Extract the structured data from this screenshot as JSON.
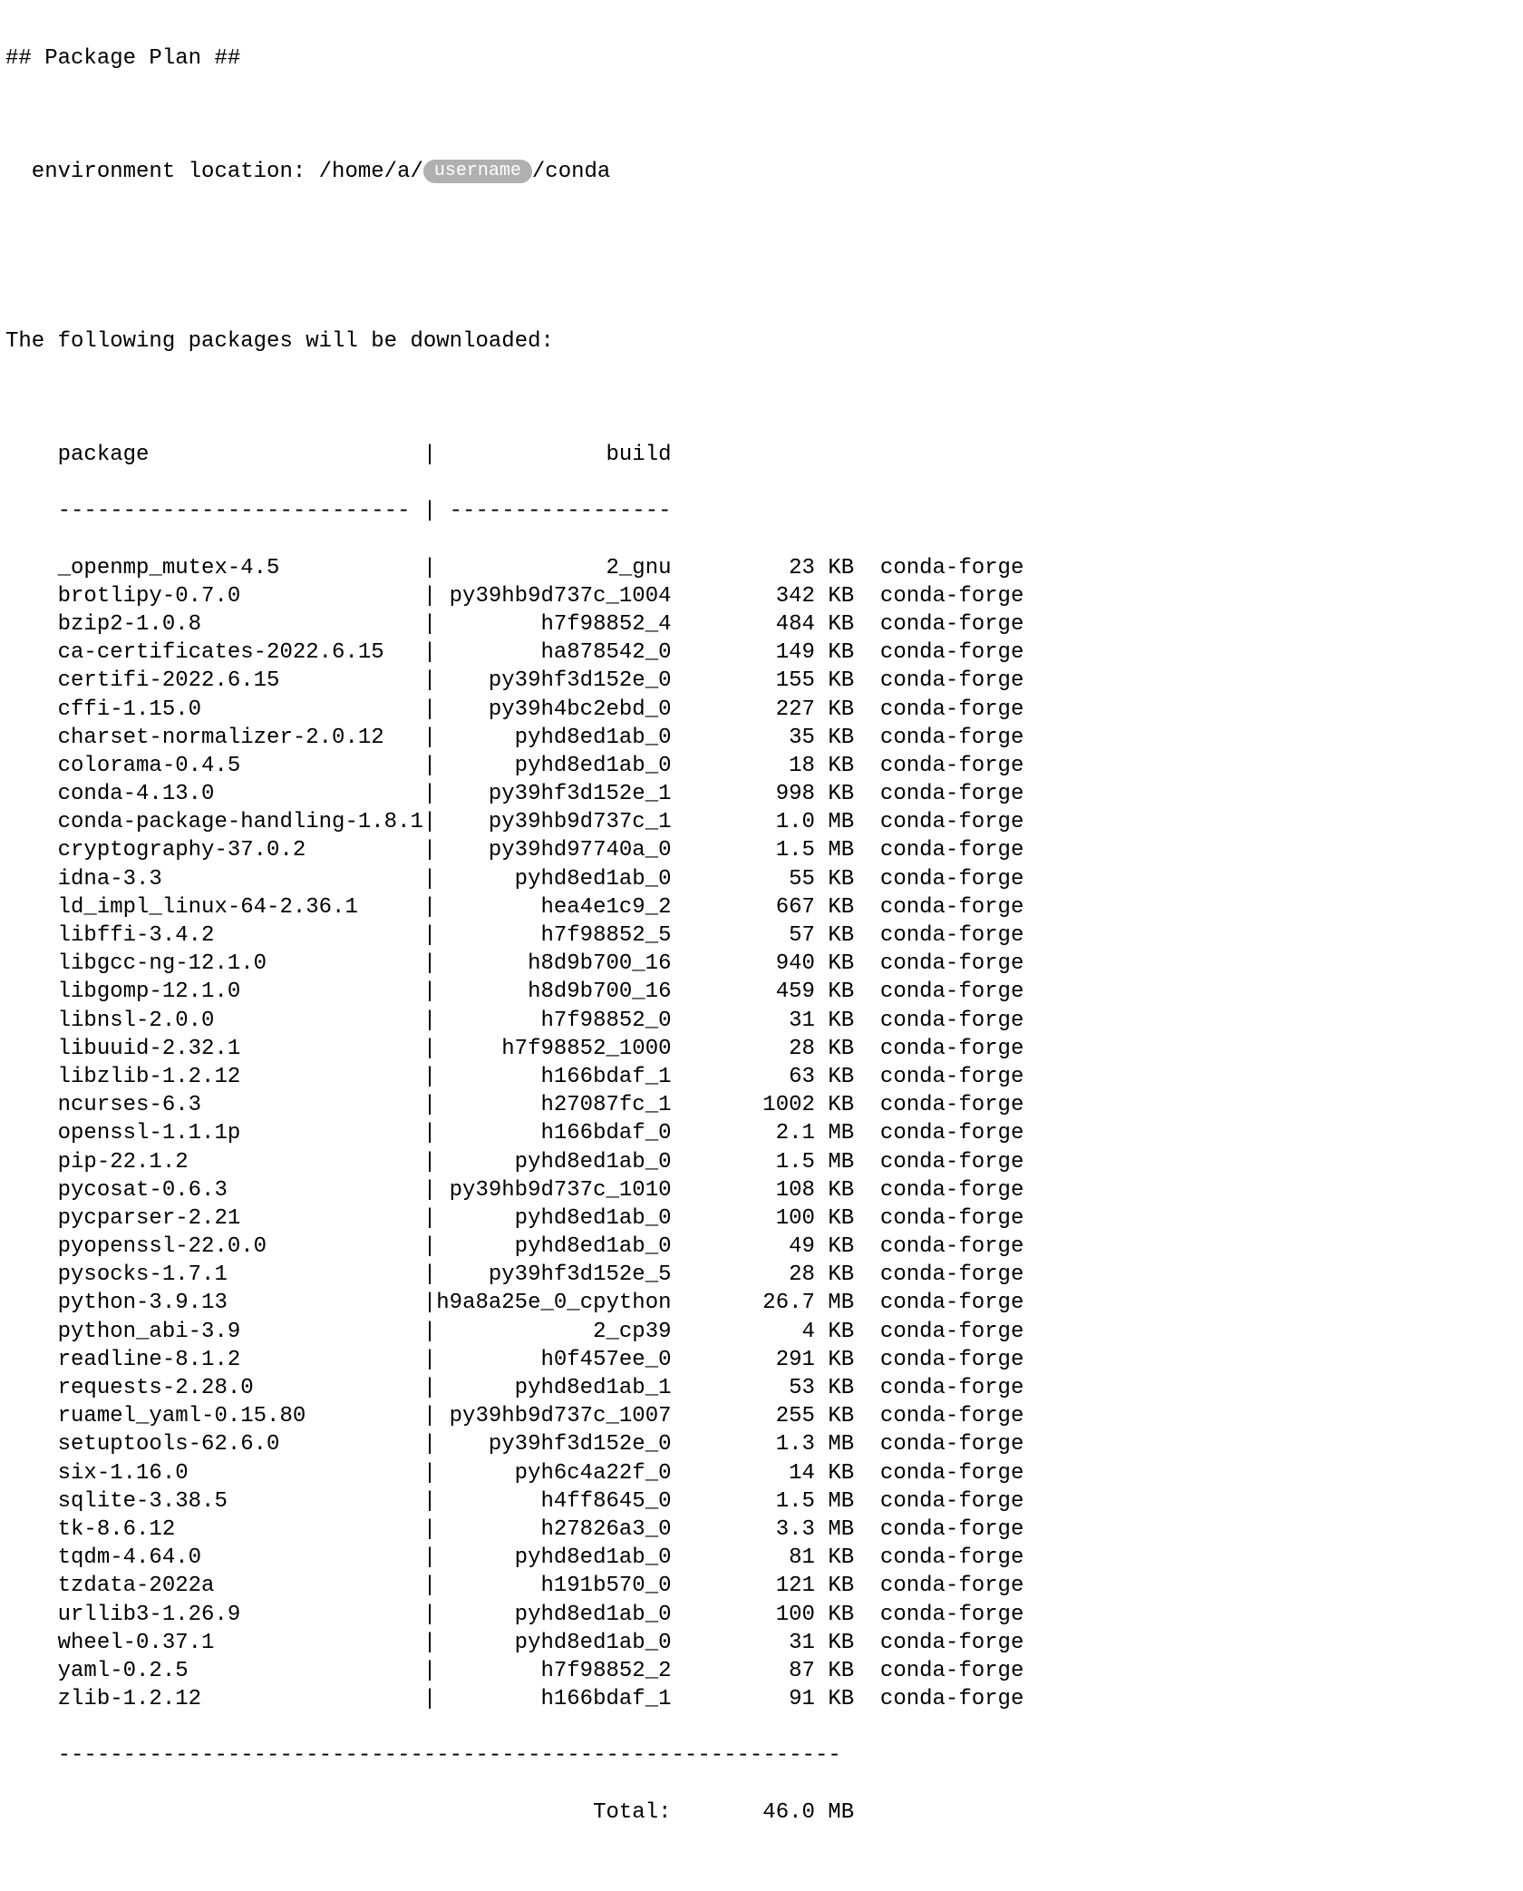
{
  "heading": "## Package Plan ##",
  "env_label_prefix": "  environment location: /home/a/",
  "env_redacted": "username",
  "env_label_suffix": "/conda",
  "download_heading": "The following packages will be downloaded:",
  "columns": {
    "package": "package",
    "build": "build"
  },
  "header_rule_left": "---------------------------",
  "header_rule_right": "-----------------",
  "packages": [
    {
      "name": "_openmp_mutex-4.5",
      "build": "2_gnu",
      "size": "23 KB",
      "channel": "conda-forge"
    },
    {
      "name": "brotlipy-0.7.0",
      "build": "py39hb9d737c_1004",
      "size": "342 KB",
      "channel": "conda-forge"
    },
    {
      "name": "bzip2-1.0.8",
      "build": "h7f98852_4",
      "size": "484 KB",
      "channel": "conda-forge"
    },
    {
      "name": "ca-certificates-2022.6.15",
      "build": "ha878542_0",
      "size": "149 KB",
      "channel": "conda-forge"
    },
    {
      "name": "certifi-2022.6.15",
      "build": "py39hf3d152e_0",
      "size": "155 KB",
      "channel": "conda-forge"
    },
    {
      "name": "cffi-1.15.0",
      "build": "py39h4bc2ebd_0",
      "size": "227 KB",
      "channel": "conda-forge"
    },
    {
      "name": "charset-normalizer-2.0.12",
      "build": "pyhd8ed1ab_0",
      "size": "35 KB",
      "channel": "conda-forge"
    },
    {
      "name": "colorama-0.4.5",
      "build": "pyhd8ed1ab_0",
      "size": "18 KB",
      "channel": "conda-forge"
    },
    {
      "name": "conda-4.13.0",
      "build": "py39hf3d152e_1",
      "size": "998 KB",
      "channel": "conda-forge"
    },
    {
      "name": "conda-package-handling-1.8.1",
      "build": "py39hb9d737c_1",
      "size": "1.0 MB",
      "channel": "conda-forge"
    },
    {
      "name": "cryptography-37.0.2",
      "build": "py39hd97740a_0",
      "size": "1.5 MB",
      "channel": "conda-forge"
    },
    {
      "name": "idna-3.3",
      "build": "pyhd8ed1ab_0",
      "size": "55 KB",
      "channel": "conda-forge"
    },
    {
      "name": "ld_impl_linux-64-2.36.1",
      "build": "hea4e1c9_2",
      "size": "667 KB",
      "channel": "conda-forge"
    },
    {
      "name": "libffi-3.4.2",
      "build": "h7f98852_5",
      "size": "57 KB",
      "channel": "conda-forge"
    },
    {
      "name": "libgcc-ng-12.1.0",
      "build": "h8d9b700_16",
      "size": "940 KB",
      "channel": "conda-forge"
    },
    {
      "name": "libgomp-12.1.0",
      "build": "h8d9b700_16",
      "size": "459 KB",
      "channel": "conda-forge"
    },
    {
      "name": "libnsl-2.0.0",
      "build": "h7f98852_0",
      "size": "31 KB",
      "channel": "conda-forge"
    },
    {
      "name": "libuuid-2.32.1",
      "build": "h7f98852_1000",
      "size": "28 KB",
      "channel": "conda-forge"
    },
    {
      "name": "libzlib-1.2.12",
      "build": "h166bdaf_1",
      "size": "63 KB",
      "channel": "conda-forge"
    },
    {
      "name": "ncurses-6.3",
      "build": "h27087fc_1",
      "size": "1002 KB",
      "channel": "conda-forge"
    },
    {
      "name": "openssl-1.1.1p",
      "build": "h166bdaf_0",
      "size": "2.1 MB",
      "channel": "conda-forge"
    },
    {
      "name": "pip-22.1.2",
      "build": "pyhd8ed1ab_0",
      "size": "1.5 MB",
      "channel": "conda-forge"
    },
    {
      "name": "pycosat-0.6.3",
      "build": "py39hb9d737c_1010",
      "size": "108 KB",
      "channel": "conda-forge"
    },
    {
      "name": "pycparser-2.21",
      "build": "pyhd8ed1ab_0",
      "size": "100 KB",
      "channel": "conda-forge"
    },
    {
      "name": "pyopenssl-22.0.0",
      "build": "pyhd8ed1ab_0",
      "size": "49 KB",
      "channel": "conda-forge"
    },
    {
      "name": "pysocks-1.7.1",
      "build": "py39hf3d152e_5",
      "size": "28 KB",
      "channel": "conda-forge"
    },
    {
      "name": "python-3.9.13",
      "build": "h9a8a25e_0_cpython",
      "size": "26.7 MB",
      "channel": "conda-forge"
    },
    {
      "name": "python_abi-3.9",
      "build": "2_cp39",
      "size": "4 KB",
      "channel": "conda-forge"
    },
    {
      "name": "readline-8.1.2",
      "build": "h0f457ee_0",
      "size": "291 KB",
      "channel": "conda-forge"
    },
    {
      "name": "requests-2.28.0",
      "build": "pyhd8ed1ab_1",
      "size": "53 KB",
      "channel": "conda-forge"
    },
    {
      "name": "ruamel_yaml-0.15.80",
      "build": "py39hb9d737c_1007",
      "size": "255 KB",
      "channel": "conda-forge"
    },
    {
      "name": "setuptools-62.6.0",
      "build": "py39hf3d152e_0",
      "size": "1.3 MB",
      "channel": "conda-forge"
    },
    {
      "name": "six-1.16.0",
      "build": "pyh6c4a22f_0",
      "size": "14 KB",
      "channel": "conda-forge"
    },
    {
      "name": "sqlite-3.38.5",
      "build": "h4ff8645_0",
      "size": "1.5 MB",
      "channel": "conda-forge"
    },
    {
      "name": "tk-8.6.12",
      "build": "h27826a3_0",
      "size": "3.3 MB",
      "channel": "conda-forge"
    },
    {
      "name": "tqdm-4.64.0",
      "build": "pyhd8ed1ab_0",
      "size": "81 KB",
      "channel": "conda-forge"
    },
    {
      "name": "tzdata-2022a",
      "build": "h191b570_0",
      "size": "121 KB",
      "channel": "conda-forge"
    },
    {
      "name": "urllib3-1.26.9",
      "build": "pyhd8ed1ab_0",
      "size": "100 KB",
      "channel": "conda-forge"
    },
    {
      "name": "wheel-0.37.1",
      "build": "pyhd8ed1ab_0",
      "size": "31 KB",
      "channel": "conda-forge"
    },
    {
      "name": "yaml-0.2.5",
      "build": "h7f98852_2",
      "size": "87 KB",
      "channel": "conda-forge"
    },
    {
      "name": "zlib-1.2.12",
      "build": "h166bdaf_1",
      "size": "91 KB",
      "channel": "conda-forge"
    }
  ],
  "footer_rule": "------------------------------------------------------------",
  "total_label": "Total:",
  "total_size": "46.0 MB"
}
